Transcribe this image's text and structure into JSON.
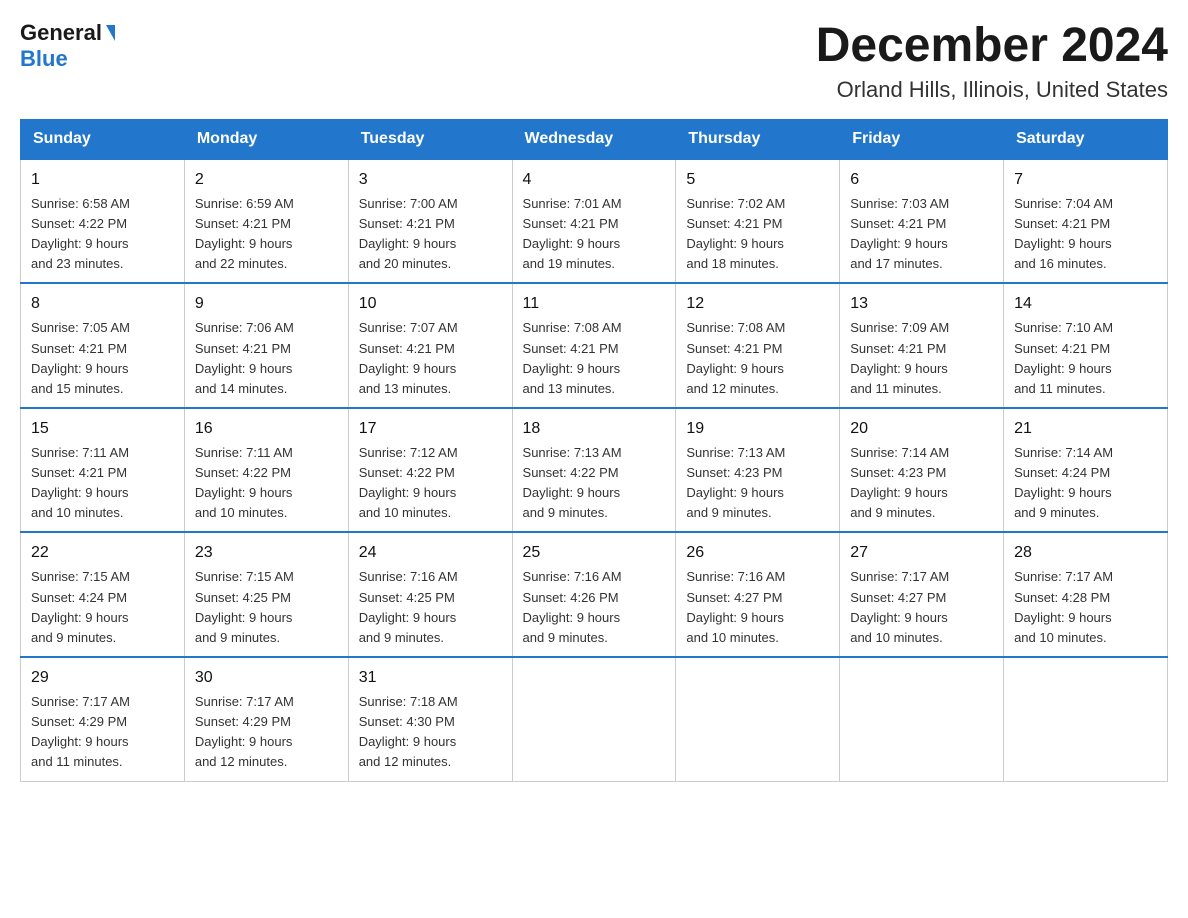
{
  "header": {
    "logo_general": "General",
    "logo_blue": "Blue",
    "month_year": "December 2024",
    "location": "Orland Hills, Illinois, United States"
  },
  "days_of_week": [
    "Sunday",
    "Monday",
    "Tuesday",
    "Wednesday",
    "Thursday",
    "Friday",
    "Saturday"
  ],
  "weeks": [
    [
      {
        "day": "1",
        "sunrise": "6:58 AM",
        "sunset": "4:22 PM",
        "daylight": "9 hours and 23 minutes."
      },
      {
        "day": "2",
        "sunrise": "6:59 AM",
        "sunset": "4:21 PM",
        "daylight": "9 hours and 22 minutes."
      },
      {
        "day": "3",
        "sunrise": "7:00 AM",
        "sunset": "4:21 PM",
        "daylight": "9 hours and 20 minutes."
      },
      {
        "day": "4",
        "sunrise": "7:01 AM",
        "sunset": "4:21 PM",
        "daylight": "9 hours and 19 minutes."
      },
      {
        "day": "5",
        "sunrise": "7:02 AM",
        "sunset": "4:21 PM",
        "daylight": "9 hours and 18 minutes."
      },
      {
        "day": "6",
        "sunrise": "7:03 AM",
        "sunset": "4:21 PM",
        "daylight": "9 hours and 17 minutes."
      },
      {
        "day": "7",
        "sunrise": "7:04 AM",
        "sunset": "4:21 PM",
        "daylight": "9 hours and 16 minutes."
      }
    ],
    [
      {
        "day": "8",
        "sunrise": "7:05 AM",
        "sunset": "4:21 PM",
        "daylight": "9 hours and 15 minutes."
      },
      {
        "day": "9",
        "sunrise": "7:06 AM",
        "sunset": "4:21 PM",
        "daylight": "9 hours and 14 minutes."
      },
      {
        "day": "10",
        "sunrise": "7:07 AM",
        "sunset": "4:21 PM",
        "daylight": "9 hours and 13 minutes."
      },
      {
        "day": "11",
        "sunrise": "7:08 AM",
        "sunset": "4:21 PM",
        "daylight": "9 hours and 13 minutes."
      },
      {
        "day": "12",
        "sunrise": "7:08 AM",
        "sunset": "4:21 PM",
        "daylight": "9 hours and 12 minutes."
      },
      {
        "day": "13",
        "sunrise": "7:09 AM",
        "sunset": "4:21 PM",
        "daylight": "9 hours and 11 minutes."
      },
      {
        "day": "14",
        "sunrise": "7:10 AM",
        "sunset": "4:21 PM",
        "daylight": "9 hours and 11 minutes."
      }
    ],
    [
      {
        "day": "15",
        "sunrise": "7:11 AM",
        "sunset": "4:21 PM",
        "daylight": "9 hours and 10 minutes."
      },
      {
        "day": "16",
        "sunrise": "7:11 AM",
        "sunset": "4:22 PM",
        "daylight": "9 hours and 10 minutes."
      },
      {
        "day": "17",
        "sunrise": "7:12 AM",
        "sunset": "4:22 PM",
        "daylight": "9 hours and 10 minutes."
      },
      {
        "day": "18",
        "sunrise": "7:13 AM",
        "sunset": "4:22 PM",
        "daylight": "9 hours and 9 minutes."
      },
      {
        "day": "19",
        "sunrise": "7:13 AM",
        "sunset": "4:23 PM",
        "daylight": "9 hours and 9 minutes."
      },
      {
        "day": "20",
        "sunrise": "7:14 AM",
        "sunset": "4:23 PM",
        "daylight": "9 hours and 9 minutes."
      },
      {
        "day": "21",
        "sunrise": "7:14 AM",
        "sunset": "4:24 PM",
        "daylight": "9 hours and 9 minutes."
      }
    ],
    [
      {
        "day": "22",
        "sunrise": "7:15 AM",
        "sunset": "4:24 PM",
        "daylight": "9 hours and 9 minutes."
      },
      {
        "day": "23",
        "sunrise": "7:15 AM",
        "sunset": "4:25 PM",
        "daylight": "9 hours and 9 minutes."
      },
      {
        "day": "24",
        "sunrise": "7:16 AM",
        "sunset": "4:25 PM",
        "daylight": "9 hours and 9 minutes."
      },
      {
        "day": "25",
        "sunrise": "7:16 AM",
        "sunset": "4:26 PM",
        "daylight": "9 hours and 9 minutes."
      },
      {
        "day": "26",
        "sunrise": "7:16 AM",
        "sunset": "4:27 PM",
        "daylight": "9 hours and 10 minutes."
      },
      {
        "day": "27",
        "sunrise": "7:17 AM",
        "sunset": "4:27 PM",
        "daylight": "9 hours and 10 minutes."
      },
      {
        "day": "28",
        "sunrise": "7:17 AM",
        "sunset": "4:28 PM",
        "daylight": "9 hours and 10 minutes."
      }
    ],
    [
      {
        "day": "29",
        "sunrise": "7:17 AM",
        "sunset": "4:29 PM",
        "daylight": "9 hours and 11 minutes."
      },
      {
        "day": "30",
        "sunrise": "7:17 AM",
        "sunset": "4:29 PM",
        "daylight": "9 hours and 12 minutes."
      },
      {
        "day": "31",
        "sunrise": "7:18 AM",
        "sunset": "4:30 PM",
        "daylight": "9 hours and 12 minutes."
      },
      null,
      null,
      null,
      null
    ]
  ],
  "labels": {
    "sunrise": "Sunrise:",
    "sunset": "Sunset:",
    "daylight": "Daylight:"
  }
}
